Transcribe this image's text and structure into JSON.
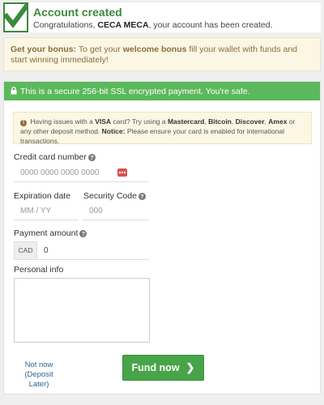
{
  "confirmation": {
    "title": "Account created",
    "message_prefix": "Congratulations, ",
    "username": "CECA MECA",
    "message_suffix": ", your account has been created."
  },
  "bonus": {
    "label": "Get your bonus:",
    "text_before": " To get your ",
    "highlight": "welcome bonus",
    "text_after": " fill your wallet with funds and start winning immediately!"
  },
  "ssl_banner": "This is a secure 256-bit SSL encrypted payment. You're safe.",
  "card_notice": {
    "t1": " Having issues with a ",
    "b1": "VISA",
    "t2": " card? Try using a ",
    "b2": "Mastercard",
    "t3": ", ",
    "b3": "Bitcoin",
    "t4": ", ",
    "b4": "Discover",
    "t5": ", ",
    "b5": "Amex",
    "t6": " or any other deposit method. ",
    "b6": "Notice:",
    "t7": " Please ensure your card is enabled for international transactions."
  },
  "form": {
    "card_number_label": "Credit card number",
    "card_number_placeholder": "0000 0000 0000 0000",
    "expiration_label": "Expiration date",
    "expiration_placeholder": "MM / YY",
    "security_label": "Security Code",
    "security_placeholder": "000",
    "amount_label": "Payment amount",
    "currency": "CAD",
    "amount_value": "0",
    "personal_label": "Personal info",
    "personal_value": ""
  },
  "actions": {
    "not_now_line1": "Not now",
    "not_now_line2": "(Deposit Later)",
    "fund_label": "Fund now"
  },
  "colors": {
    "success_green": "#5cb85c",
    "title_green": "#3b8a3b",
    "button_green": "#48a448",
    "warning_bg": "#fcf7e4",
    "link_blue": "#2a6496",
    "card_icon_red": "#d9534f"
  }
}
